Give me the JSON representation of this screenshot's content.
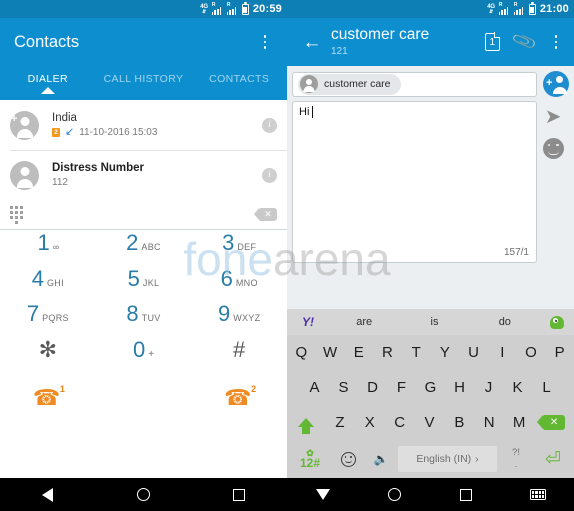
{
  "status_bar_left": {
    "network": "4G",
    "arrows": "⇵",
    "roam": "R",
    "time": "20:59"
  },
  "status_bar_right": {
    "network": "4G",
    "arrows": "⇵",
    "roam": "R",
    "time": "21:00"
  },
  "left_app": {
    "title": "Contacts",
    "overflow_icon": "more-vertical-icon",
    "tabs": [
      {
        "label": "DIALER",
        "active": true
      },
      {
        "label": "CALL HISTORY",
        "active": false
      },
      {
        "label": "CONTACTS",
        "active": false
      }
    ],
    "call_log": [
      {
        "name": "India",
        "sim": "2",
        "direction_icon": "call-received-arrow",
        "meta": "11-10-2016  15:03",
        "info": "i"
      },
      {
        "name": "Distress Number",
        "sub": "112",
        "info": "i"
      }
    ],
    "dial_strip": {
      "keypad_icon": "dialpad-icon",
      "delete_icon": "backspace-icon",
      "delete_glyph": "✕"
    },
    "dialpad": [
      [
        {
          "num": "1",
          "sub": "∞",
          "sub_type": "voicemail"
        },
        {
          "num": "2",
          "sub": "ABC"
        },
        {
          "num": "3",
          "sub": "DEF"
        }
      ],
      [
        {
          "num": "4",
          "sub": "GHI"
        },
        {
          "num": "5",
          "sub": "JKL"
        },
        {
          "num": "6",
          "sub": "MNO"
        }
      ],
      [
        {
          "num": "7",
          "sub": "PQRS"
        },
        {
          "num": "8",
          "sub": "TUV"
        },
        {
          "num": "9",
          "sub": "WXYZ"
        }
      ],
      [
        {
          "num": "✻",
          "sub": "",
          "gray": true
        },
        {
          "num": "0",
          "sub": "+"
        },
        {
          "num": "#",
          "sub": "",
          "gray": true
        }
      ]
    ],
    "call_buttons": [
      {
        "icon": "call-handset-icon",
        "badge": "1"
      },
      {
        "icon": "call-handset-icon",
        "badge": "2"
      }
    ]
  },
  "right_app": {
    "back_icon": "arrow-left-icon",
    "title": "customer care",
    "subtitle": "121",
    "sim_icon": "sim-card-icon",
    "sim_label": "1",
    "attach_icon": "paperclip-icon",
    "overflow_icon": "more-vertical-icon",
    "recipient": {
      "chip_name": "customer care",
      "avatar_icon": "contact-avatar-icon"
    },
    "add_recipient_icon": "add-person-icon",
    "message_body": "Hi",
    "char_counter": "157/1",
    "send_icon": "send-icon",
    "emoji_icon": "emoji-icon"
  },
  "keyboard": {
    "suggestions": [
      "Y!",
      "are",
      "is",
      "do"
    ],
    "mascot_icon": "green-mascot-icon",
    "row1": [
      "Q",
      "W",
      "E",
      "R",
      "T",
      "Y",
      "U",
      "I",
      "O",
      "P"
    ],
    "row2": [
      "A",
      "S",
      "D",
      "F",
      "G",
      "H",
      "J",
      "K",
      "L"
    ],
    "row3": [
      "Z",
      "X",
      "C",
      "V",
      "B",
      "N",
      "M"
    ],
    "shift_icon": "shift-icon",
    "backspace_icon": "backspace-icon",
    "backspace_glyph": "✕",
    "numeric_label": "12#",
    "gear_icon": "gear-icon",
    "gear_glyph": "✿",
    "emoji_icon": "emoji-key-icon",
    "mic_icon": "microphone-icon",
    "mic_glyph": "🎤",
    "space_label": "English (IN)",
    "space_chevron": "›",
    "punct_top": "?!",
    "punct_bottom": ".",
    "enter_icon": "enter-key-icon",
    "enter_glyph": "⏎"
  },
  "nav_left": [
    {
      "icon": "back-triangle-icon"
    },
    {
      "icon": "home-circle-icon"
    },
    {
      "icon": "recents-square-icon"
    }
  ],
  "nav_right": [
    {
      "icon": "hide-keyboard-triangle-icon"
    },
    {
      "icon": "home-circle-icon"
    },
    {
      "icon": "recents-square-icon"
    },
    {
      "icon": "keyboard-icon"
    }
  ],
  "watermark": {
    "left_part": "fone",
    "right_part": "arena"
  },
  "colors": {
    "app_blue": "#0d8ecf",
    "status_blue": "#0d7fb5",
    "accent_orange": "#ef8b22",
    "key_green": "#62b833"
  }
}
